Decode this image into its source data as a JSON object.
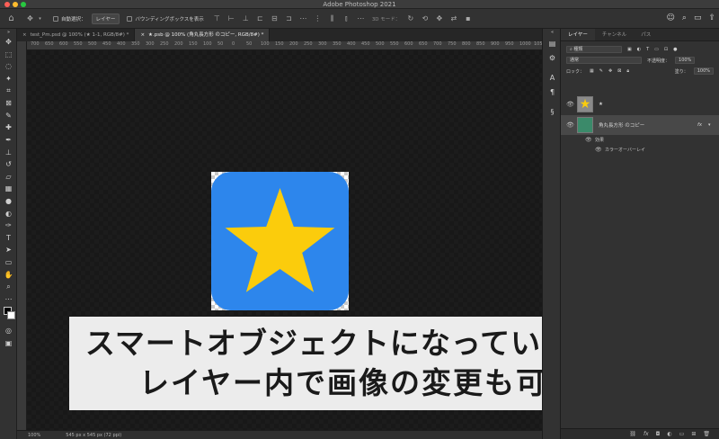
{
  "window": {
    "title": "Adobe Photoshop 2021"
  },
  "options_bar": {
    "auto_select_label": "自動選択：",
    "auto_select_value": "レイヤー",
    "show_transform_label": "バウンディングボックスを表示",
    "mode_3d": "3D モード："
  },
  "tabs": [
    {
      "label": "test_Pm.psd @ 100% (★ 1-1, RGB/8#) *"
    },
    {
      "label": "★.psb @ 100% (角丸長方形 のコピー, RGB/8#) *"
    }
  ],
  "ruler": {
    "ticks": [
      "700",
      "650",
      "600",
      "550",
      "500",
      "450",
      "400",
      "350",
      "300",
      "250",
      "200",
      "150",
      "100",
      "50",
      "0",
      "50",
      "100",
      "150",
      "200",
      "250",
      "300",
      "350",
      "400",
      "450",
      "500",
      "550",
      "600",
      "650",
      "700",
      "750",
      "800",
      "850",
      "900",
      "950",
      "1000",
      "1050",
      "1100",
      "1150",
      "1200",
      "1250"
    ]
  },
  "caption": {
    "line1": "スマートオブジェクトになっているので",
    "line2": "レイヤー内で画像の変更も可能"
  },
  "status": {
    "zoom": "100%",
    "doc_info": "545 px x 545 px (72 ppi)"
  },
  "layers_panel": {
    "tabs": [
      "レイヤー",
      "チャンネル",
      "パス"
    ],
    "filter_label": "種類",
    "blend_mode": "通常",
    "opacity_label": "不透明度：",
    "opacity_value": "100%",
    "lock_label": "ロック：",
    "fill_label": "塗り：",
    "fill_value": "100%",
    "layers": [
      {
        "name": "★"
      },
      {
        "name": "角丸長方形 のコピー",
        "fx": "fx"
      }
    ],
    "effects_label": "効果",
    "effect_item": "カラーオーバーレイ"
  },
  "colors": {
    "canvas_bg": "#181818",
    "square": "#2d86ec",
    "star": "#fbcc0c",
    "caption_bg": "#ececec"
  }
}
